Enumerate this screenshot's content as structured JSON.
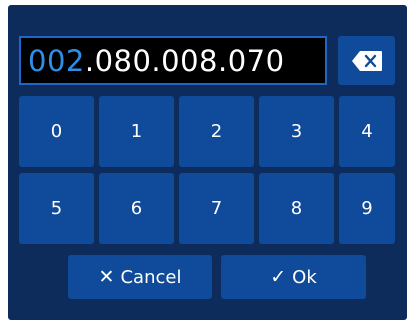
{
  "display": {
    "typed": "002",
    "remaining": ".080.008.070"
  },
  "keypad": {
    "row1": [
      "0",
      "1",
      "2",
      "3",
      "4"
    ],
    "row2": [
      "5",
      "6",
      "7",
      "8",
      "9"
    ]
  },
  "actions": {
    "cancel_icon": "✕",
    "cancel_label": "Cancel",
    "ok_icon": "✓",
    "ok_label": "Ok"
  },
  "icons": {
    "backspace": "backspace-icon",
    "cancel": "cross-icon",
    "ok": "check-icon"
  },
  "colors": {
    "panel": "#0d2b5b",
    "key": "#104a9a",
    "display_bg": "#000000",
    "display_border": "#1f66c7",
    "typed_text": "#2e8fe8",
    "text": "#ffffff"
  }
}
